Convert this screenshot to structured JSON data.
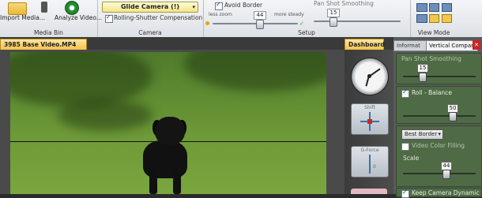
{
  "ribbon": {
    "media_bin": {
      "label": "Media Bin",
      "import_label": "Import Media...",
      "analyze_label": "Analyze Video..."
    },
    "camera": {
      "label": "Camera",
      "preset": "Glide Camera (!)",
      "rolling_shutter_label": "Rolling-Shutter Compensation",
      "rolling_shutter_checked": true
    },
    "setup": {
      "label": "Setup",
      "avoid_border_label": "Avoid Border",
      "avoid_border_checked": true,
      "less_zoom_label": "less zoom",
      "more_steady_label": "more steady",
      "zoom_value": "44",
      "pan_smoothing_label": "Pan Shot Smoothing",
      "pan_value": "15"
    },
    "view_mode": {
      "label": "View Mode"
    }
  },
  "tabs": {
    "video_tab": "3985 Base Video.MP4",
    "dashboard_tab": "Dashboard"
  },
  "dashboard": {
    "shift_label": "Shift",
    "gforce_label": "G-Force",
    "gforce_value": "0"
  },
  "right_panel": {
    "tab_info": "Informat",
    "tab_vertical_compare": "Vertical Compare",
    "pan_smoothing_label": "Pan Shot Smoothing",
    "pan_value": "15",
    "roll_balance_label": "Roll - Balance",
    "roll_checked": true,
    "roll_value": "50",
    "border_select": "Best Border",
    "video_color_filling_label": "Video Color Filling",
    "video_color_filling_checked": false,
    "scale_label": "Scale",
    "scale_value": "44",
    "keep_camera_label": "Keep Camera Dynamic",
    "keep_camera_checked": true
  },
  "colors": {
    "accent": "#f3c34a",
    "panel_green": "#4f6b45"
  }
}
